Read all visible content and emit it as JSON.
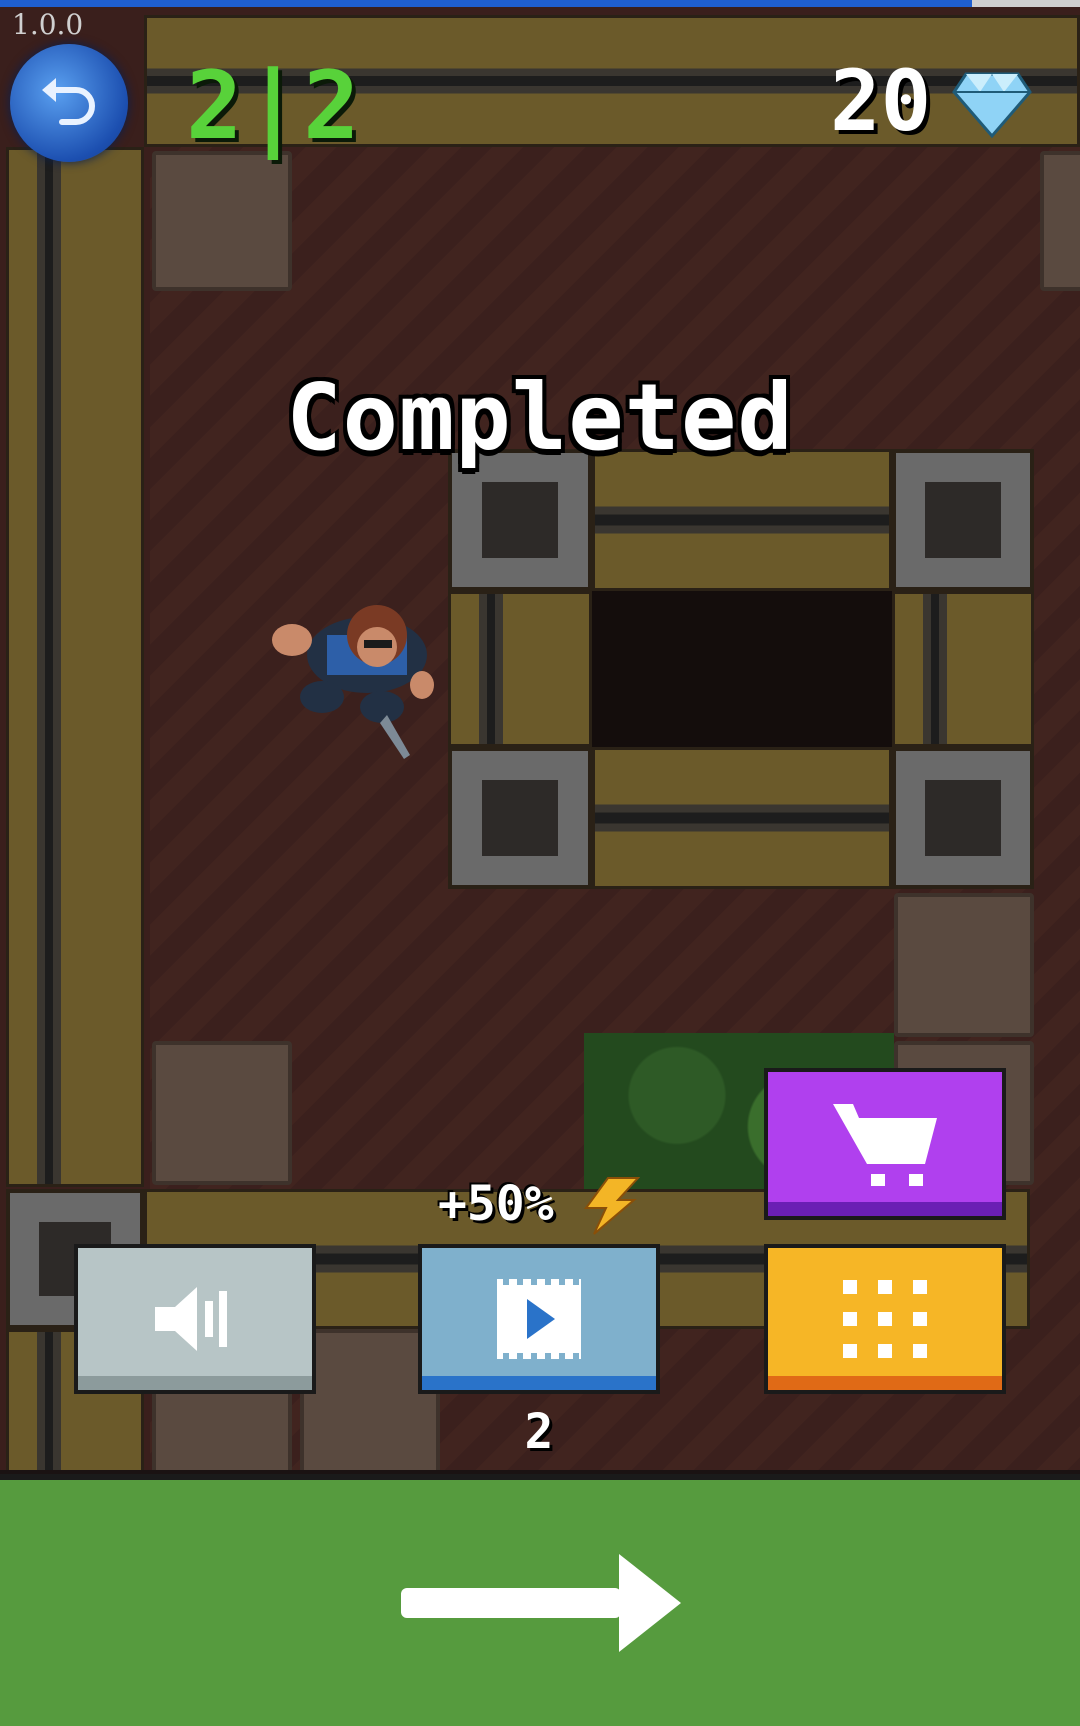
{
  "app": {
    "version": "1.0.0"
  },
  "hud": {
    "level_progress": "2|2",
    "gem_count": "20",
    "back_icon": "undo-icon",
    "gem_icon": "diamond-icon"
  },
  "message": {
    "completed": "Completed"
  },
  "buttons": {
    "sound_icon": "speaker-icon",
    "video_icon": "video-play-icon",
    "shop_icon": "cart-icon",
    "levels_icon": "grid-icon",
    "next_icon": "arrow-right-icon"
  },
  "video_bonus": {
    "label": "+50%",
    "icon": "lightning-icon",
    "count": "2"
  },
  "progress_bar": {
    "value": 0.9
  },
  "colors": {
    "level_text": "#58d23a",
    "next_bar": "#569b3e",
    "shop_button": "#b040ee",
    "levels_button": "#f6b626",
    "video_button": "#7fb0cc",
    "sound_button": "#b7c5c6"
  }
}
